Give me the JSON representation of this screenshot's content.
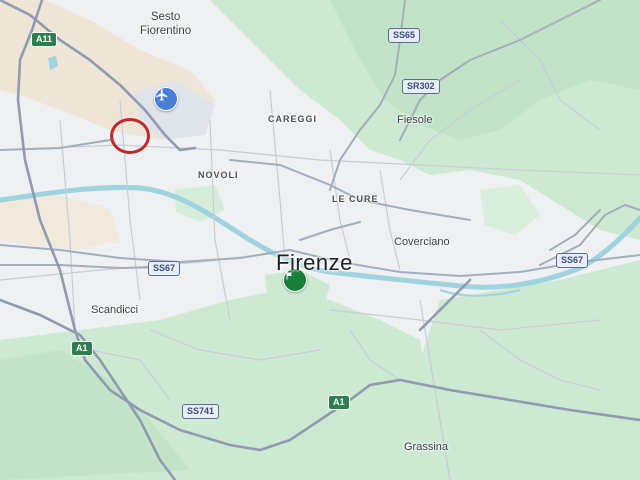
{
  "colors": {
    "park": "#cde9d2",
    "urban": "#eef0f2",
    "industrial": "#eee5d7",
    "river": "#9fd3e0",
    "road": "#a2adbd",
    "motorway": "#8e9bb0",
    "highlight": "#c1272d",
    "airport_pin": "#4a7fd6",
    "city_pin": "#188038"
  },
  "places": {
    "sesto": "Sesto\nFiorentino",
    "careggi": "CAREGGI",
    "fiesole": "Fiesole",
    "novoli": "NOVOLI",
    "le_cure": "LE CURE",
    "coverciano": "Coverciano",
    "firenze": "Firenze",
    "scandicci": "Scandicci",
    "grassina": "Grassina"
  },
  "shields": {
    "a11": "A11",
    "ss65": "SS65",
    "sr302": "SR302",
    "ss67_west": "SS67",
    "ss67_east": "SS67",
    "a1_west": "A1",
    "a1_south": "A1",
    "ss741": "SS741"
  },
  "icons": {
    "airport": "airplane-icon",
    "city_marker": "flag-icon",
    "highlight": "highlight-circle"
  }
}
